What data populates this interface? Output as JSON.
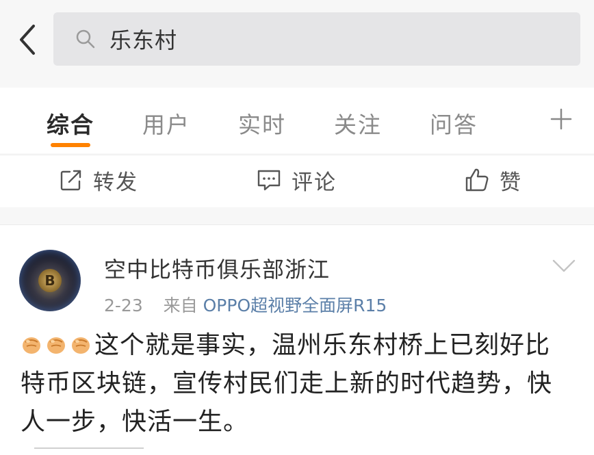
{
  "search": {
    "query": "乐东村"
  },
  "tabs": [
    {
      "label": "综合",
      "active": true
    },
    {
      "label": "用户",
      "active": false
    },
    {
      "label": "实时",
      "active": false
    },
    {
      "label": "关注",
      "active": false
    },
    {
      "label": "问答",
      "active": false
    }
  ],
  "actions": {
    "repost_label": "转发",
    "comment_label": "评论",
    "like_label": "赞"
  },
  "post": {
    "author": "空中比特币俱乐部浙江",
    "date": "2-23",
    "source_prefix": "来自 ",
    "source": "OPPO超视野全面屏R15",
    "body": "这个就是事实，温州乐东村桥上已刻好比特币区块链，宣传村民们走上新的时代趋势，快人一步，快活一生。",
    "emoji_count": 3
  },
  "colors": {
    "accent": "#ff8200",
    "source_link": "#5b7fa8"
  },
  "icons": [
    "back-arrow-icon",
    "search-icon",
    "plus-icon",
    "repost-icon",
    "comment-icon",
    "like-icon",
    "chevron-down-icon",
    "fist-emoji-icon"
  ]
}
